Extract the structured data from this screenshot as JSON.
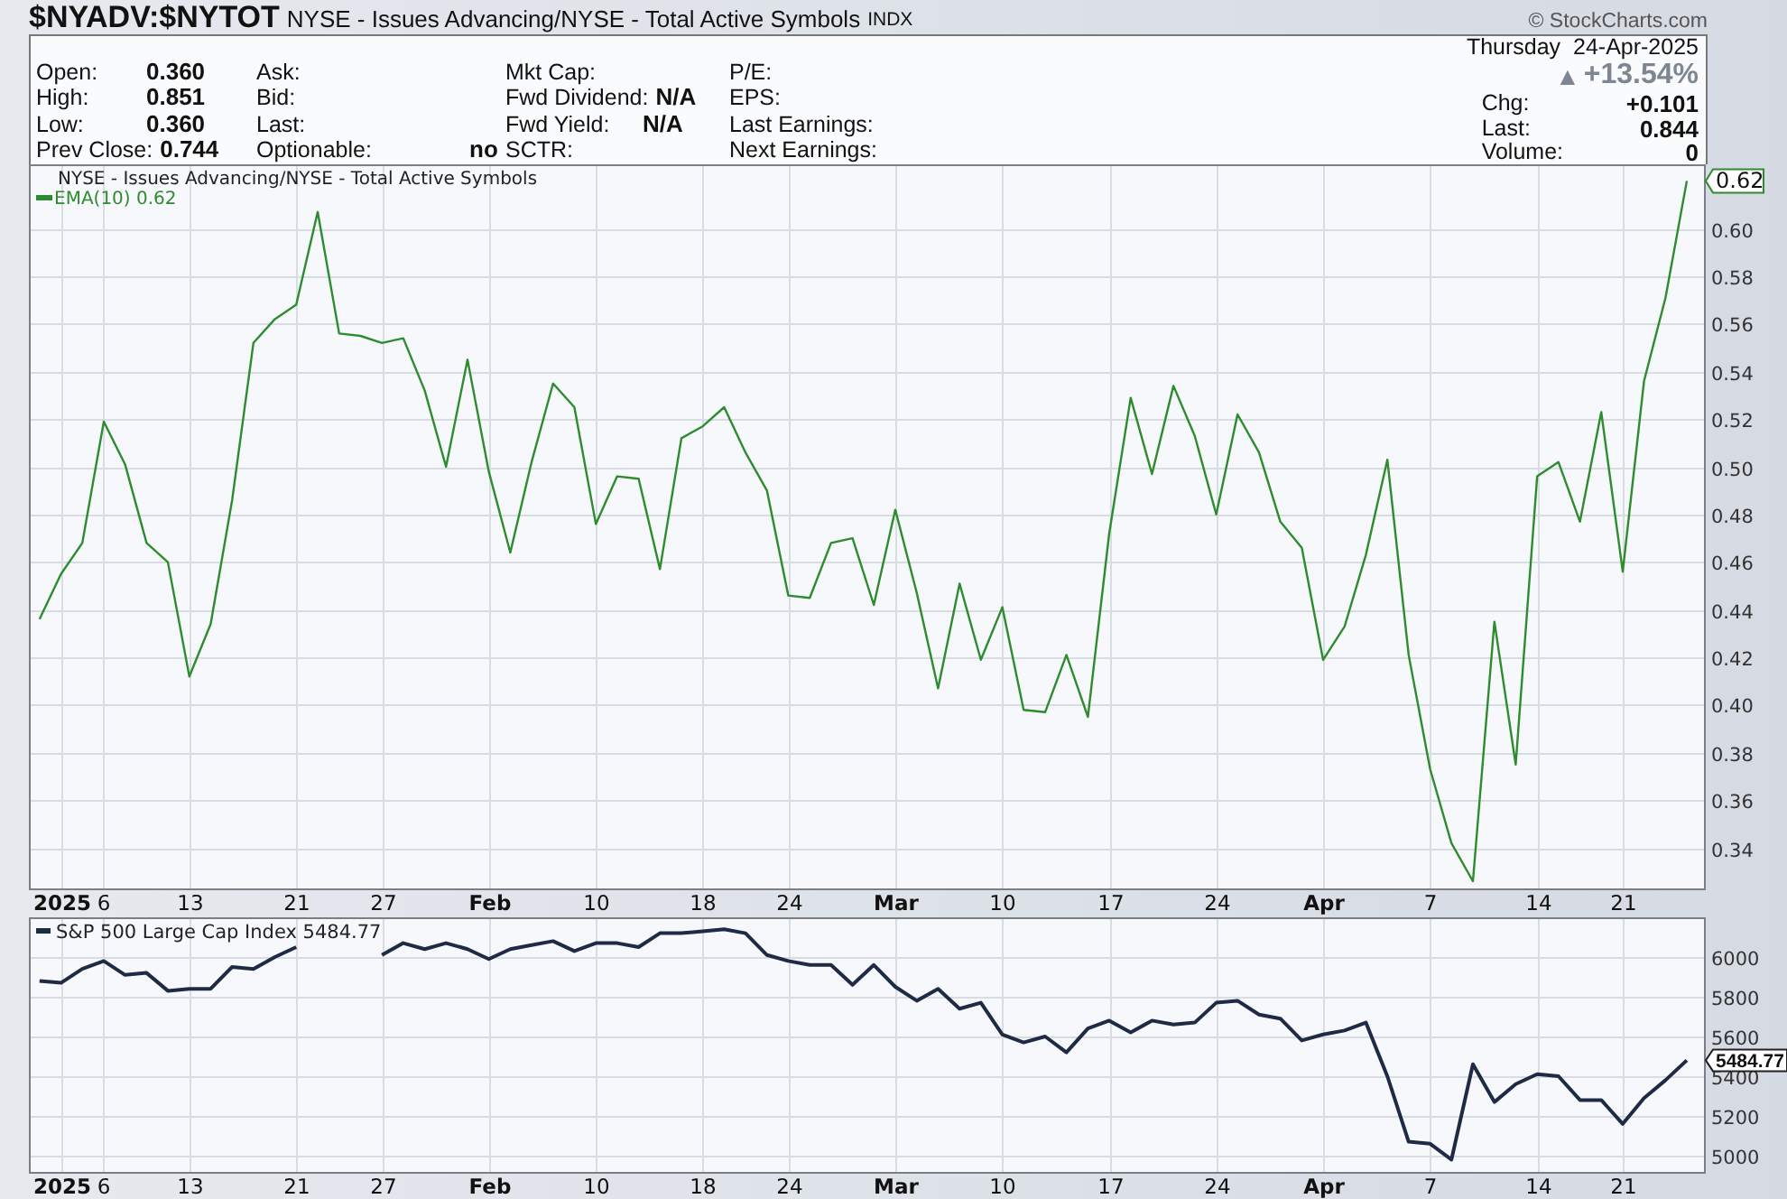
{
  "header": {
    "symbol": "$NYADV:$NYTOT",
    "name": "NYSE - Issues Advancing/NYSE - Total Active Symbols",
    "exchange": "INDX",
    "copyright": "© StockCharts.com"
  },
  "quote": {
    "fields": [
      {
        "label": "Open:",
        "value": "0.360"
      },
      {
        "label": "Ask:"
      },
      {
        "label": "Mkt Cap:"
      },
      {
        "label": "P/E:"
      },
      {
        "label": "High:",
        "value": "0.851"
      },
      {
        "label": "Bid:"
      },
      {
        "label": "Fwd Dividend:",
        "value": "N/A"
      },
      {
        "label": "EPS:"
      },
      {
        "label": "Low:",
        "value": "0.360"
      },
      {
        "label": "Last:"
      },
      {
        "label": "Fwd Yield:",
        "value": "N/A"
      },
      {
        "label": "Last Earnings:"
      },
      {
        "label": "Prev Close:",
        "value": "0.744"
      },
      {
        "label": "Optionable:",
        "value": "no"
      },
      {
        "label": "SCTR:"
      },
      {
        "label": "Next Earnings:"
      }
    ],
    "weekday": "Thursday",
    "date": "24-Apr-2025",
    "arrow": "▲",
    "change_pct": "+13.54%",
    "stats": [
      {
        "label": "Chg:",
        "value": "+0.101"
      },
      {
        "label": "Last:",
        "value": "0.844"
      },
      {
        "label": "Volume:",
        "value": "0"
      }
    ]
  },
  "panels": [
    {
      "legend_value": "0.62",
      "last_label": "0.62",
      "chart_data": {
        "type": "line",
        "title": "NYSE - Issues Advancing/NYSE - Total Active Symbols",
        "grid": true,
        "categories": [
          null,
          "2025",
          null,
          "6",
          null,
          null,
          null,
          "13",
          null,
          null,
          null,
          null,
          "21",
          null,
          null,
          null,
          "27",
          null,
          null,
          null,
          null,
          "Feb",
          null,
          null,
          null,
          null,
          "10",
          null,
          null,
          null,
          null,
          "18",
          null,
          null,
          null,
          "24",
          null,
          null,
          null,
          null,
          "Mar",
          null,
          null,
          null,
          null,
          "10",
          null,
          null,
          null,
          null,
          "17",
          null,
          null,
          null,
          null,
          "24",
          null,
          null,
          null,
          null,
          "Apr",
          null,
          null,
          null,
          null,
          "7",
          null,
          null,
          null,
          null,
          "14",
          null,
          null,
          null,
          "21",
          null,
          null,
          null
        ],
        "ylim": [
          0.323,
          0.627
        ],
        "yticks": [
          {
            "value": 0.34,
            "label": "0.34"
          },
          {
            "value": 0.36,
            "label": "0.36"
          },
          {
            "value": 0.38,
            "label": "0.38"
          },
          {
            "value": 0.4,
            "label": "0.40"
          },
          {
            "value": 0.42,
            "label": "0.42"
          },
          {
            "value": 0.44,
            "label": "0.44"
          },
          {
            "value": 0.46,
            "label": "0.46"
          },
          {
            "value": 0.48,
            "label": "0.48"
          },
          {
            "value": 0.5,
            "label": "0.50"
          },
          {
            "value": 0.52,
            "label": "0.52"
          },
          {
            "value": 0.54,
            "label": "0.54"
          },
          {
            "value": 0.56,
            "label": "0.56"
          },
          {
            "value": 0.58,
            "label": "0.58"
          },
          {
            "value": 0.6,
            "label": "0.60"
          }
        ],
        "series": [
          {
            "name": "EMA(10)",
            "color": "#2e8b2e",
            "values": [
              0.436,
              0.455,
              0.468,
              0.519,
              0.501,
              0.468,
              0.46,
              0.412,
              0.434,
              0.486,
              0.552,
              0.562,
              0.568,
              0.607,
              0.556,
              0.555,
              0.552,
              0.554,
              0.532,
              0.5,
              0.545,
              0.498,
              0.464,
              0.502,
              0.535,
              0.525,
              0.476,
              0.496,
              0.495,
              0.457,
              0.512,
              0.517,
              0.525,
              0.506,
              0.49,
              0.446,
              0.445,
              0.468,
              0.47,
              0.442,
              0.482,
              0.447,
              0.407,
              0.451,
              0.419,
              0.441,
              0.398,
              0.397,
              0.421,
              0.395,
              0.472,
              0.529,
              0.497,
              0.534,
              0.513,
              0.48,
              0.522,
              0.506,
              0.477,
              0.466,
              0.419,
              0.433,
              0.463,
              0.503,
              0.421,
              0.373,
              0.342,
              0.326,
              0.435,
              0.375,
              0.496,
              0.502,
              0.477,
              0.523,
              0.456,
              0.536,
              0.571,
              0.62
            ]
          }
        ]
      }
    },
    {
      "legend_value": "5484.77",
      "last_label": "5484.77",
      "chart_data": {
        "type": "line",
        "grid": true,
        "categories": [
          null,
          "2025",
          null,
          "6",
          null,
          null,
          null,
          "13",
          null,
          null,
          null,
          null,
          "21",
          null,
          null,
          null,
          "27",
          null,
          null,
          null,
          null,
          "Feb",
          null,
          null,
          null,
          null,
          "10",
          null,
          null,
          null,
          null,
          "18",
          null,
          null,
          null,
          "24",
          null,
          null,
          null,
          null,
          "Mar",
          null,
          null,
          null,
          null,
          "10",
          null,
          null,
          null,
          null,
          "17",
          null,
          null,
          null,
          null,
          "24",
          null,
          null,
          null,
          null,
          "Apr",
          null,
          null,
          null,
          null,
          "7",
          null,
          null,
          null,
          null,
          "14",
          null,
          null,
          null,
          "21",
          null,
          null,
          null
        ],
        "ylim": [
          4918,
          6200
        ],
        "yticks": [
          {
            "value": 5000,
            "label": "5000"
          },
          {
            "value": 5200,
            "label": "5200"
          },
          {
            "value": 5400,
            "label": "5400"
          },
          {
            "value": 5600,
            "label": "5600"
          },
          {
            "value": 5800,
            "label": "5800"
          },
          {
            "value": 6000,
            "label": "6000"
          }
        ],
        "series": [
          {
            "name": "S&P 500 Large Cap Index",
            "color": "#1f2a44",
            "values": [
              5880,
              5870,
              5940,
              5980,
              5910,
              5920,
              5830,
              5840,
              5840,
              5950,
              5940,
              6000,
              6050,
              null,
              null,
              null,
              6010,
              6070,
              6040,
              6070,
              6040,
              5990,
              6040,
              6060,
              6080,
              6030,
              6070,
              6070,
              6050,
              6120,
              6120,
              6130,
              6140,
              6120,
              6010,
              5980,
              5960,
              5960,
              5860,
              5960,
              5850,
              5780,
              5840,
              5740,
              5770,
              5610,
              5570,
              5600,
              5520,
              5640,
              5680,
              5620,
              5680,
              5660,
              5670,
              5770,
              5780,
              5710,
              5690,
              5580,
              5610,
              5630,
              5670,
              5400,
              5070,
              5060,
              4980,
              5460,
              5270,
              5360,
              5410,
              5400,
              5280,
              5280,
              5160,
              5290,
              5380,
              5480
            ]
          }
        ]
      }
    }
  ]
}
